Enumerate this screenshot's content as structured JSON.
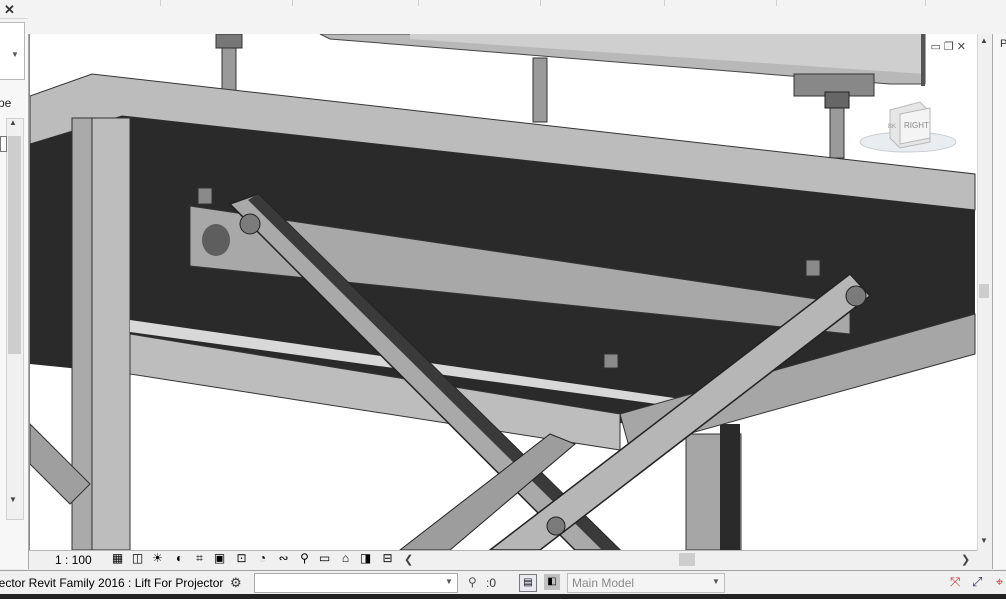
{
  "left_panel": {
    "close_glyph": "✕",
    "type_label": "pe"
  },
  "view_control_bar": {
    "scale": "1 : 100"
  },
  "status_bar": {
    "title": "jector Revit Family 2016 : Lift For Projector",
    "selection_count": ":0",
    "model_combo": "Main Model"
  },
  "navigation": {
    "view_cube_face": "RIGHT",
    "view_cube_side": "BK"
  },
  "icons": {
    "vcb": [
      "detail-level-icon",
      "visual-style-icon",
      "sun-path-icon",
      "shadows-icon",
      "crop-view-icon",
      "show-crop-icon",
      "unlock-3d-icon",
      "temporary-hide-icon",
      "reveal-hidden-icon",
      "analytical-model-icon",
      "highlight-displacement-icon",
      "render-icon",
      "worksharing-icon",
      "hide-crop-icon"
    ]
  }
}
